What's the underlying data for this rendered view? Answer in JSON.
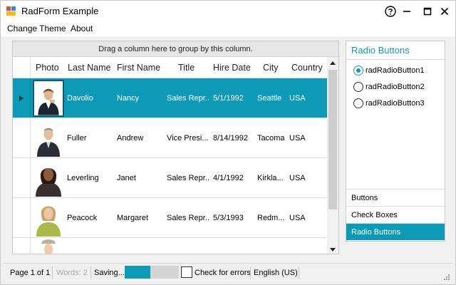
{
  "window": {
    "title": "RadForm Example"
  },
  "menu": {
    "items": [
      "Change Theme",
      "About"
    ]
  },
  "grid": {
    "group_panel_text": "Drag a column here to group by this column.",
    "columns": [
      "Photo",
      "Last Name",
      "First Name",
      "Title",
      "Hire Date",
      "City",
      "Country"
    ],
    "rows": [
      {
        "last": "Davolio",
        "first": "Nancy",
        "title": "Sales Repr...",
        "hire": "5/1/1992",
        "city": "Seattle",
        "country": "USA",
        "selected": true
      },
      {
        "last": "Fuller",
        "first": "Andrew",
        "title": "Vice Presi...",
        "hire": "8/14/1992",
        "city": "Tacoma",
        "country": "USA",
        "selected": false
      },
      {
        "last": "Leverling",
        "first": "Janet",
        "title": "Sales Repr...",
        "hire": "4/1/1992",
        "city": "Kirkla...",
        "country": "USA",
        "selected": false
      },
      {
        "last": "Peacock",
        "first": "Margaret",
        "title": "Sales Repr...",
        "hire": "5/3/1993",
        "city": "Redm...",
        "country": "USA",
        "selected": false
      },
      {
        "last": "",
        "first": "",
        "title": "",
        "hire": "",
        "city": "",
        "country": "",
        "selected": false
      }
    ]
  },
  "panelbar": {
    "title": "Radio Buttons",
    "radios": [
      {
        "label": "radRadioButton1",
        "checked": true
      },
      {
        "label": "radRadioButton2",
        "checked": false
      },
      {
        "label": "radRadioButton3",
        "checked": false
      }
    ],
    "sections": [
      {
        "label": "Buttons",
        "active": false
      },
      {
        "label": "Check Boxes",
        "active": false
      },
      {
        "label": "Radio Buttons",
        "active": true
      }
    ]
  },
  "status": {
    "page": "Page 1 of 1",
    "words": "Words: 2",
    "saving": "Saving...",
    "progress_fraction": 0.48,
    "check_errors": "Check for errors",
    "language": "English (US)"
  },
  "colors": {
    "accent": "#0c9ab7"
  },
  "icons": {
    "app": "app-icon",
    "help": "help-icon",
    "minimize": "minimize-icon",
    "maximize": "maximize-icon",
    "close": "close-icon",
    "current_row": "row-indicator-icon",
    "scroll_up": "scroll-up-arrow-icon",
    "scroll_down": "scroll-down-arrow-icon",
    "grip": "size-grip-icon"
  }
}
